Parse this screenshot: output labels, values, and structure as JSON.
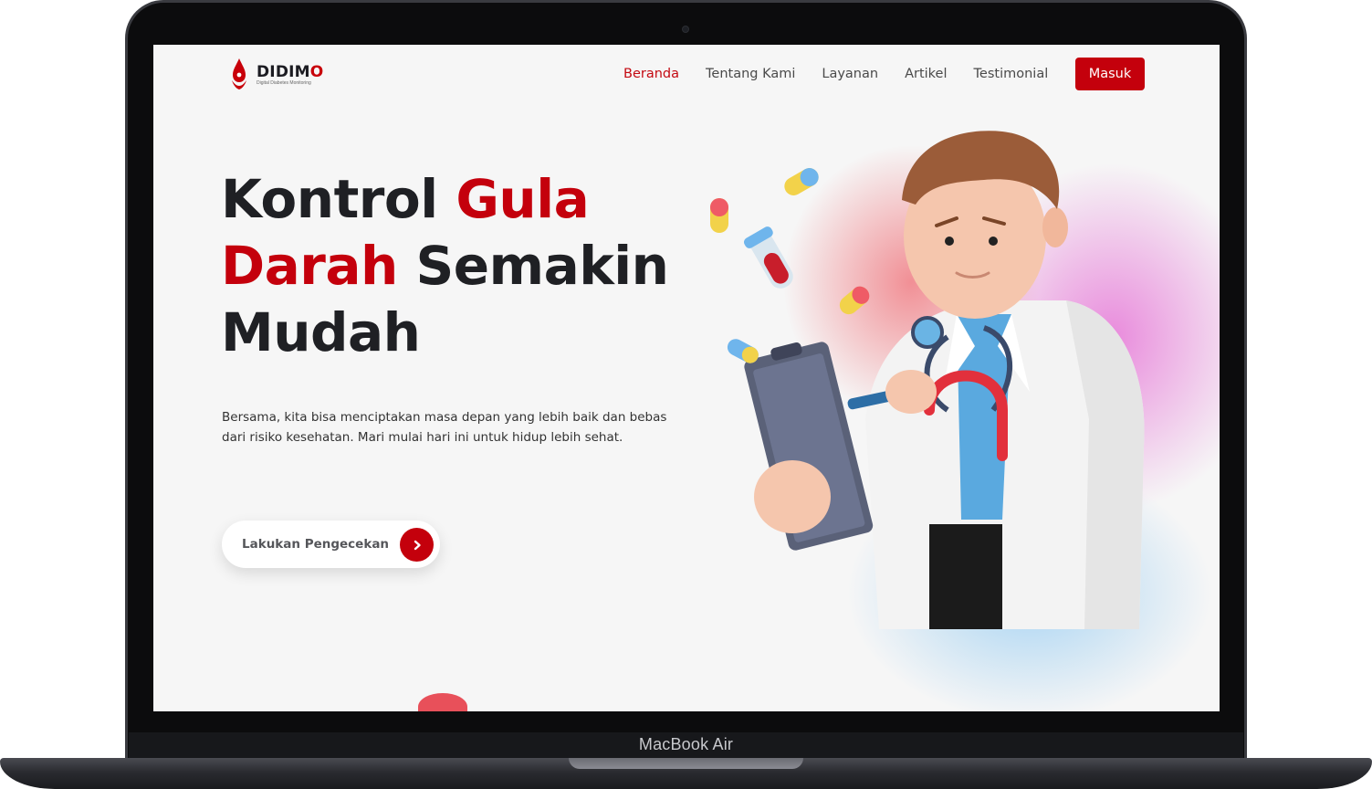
{
  "device": {
    "label": "MacBook Air"
  },
  "brand": {
    "name_main": "DIDIM",
    "name_accent": "O",
    "tagline": "Digital Diabetes Monitoring"
  },
  "nav": {
    "items": [
      {
        "label": "Beranda",
        "active": true
      },
      {
        "label": "Tentang Kami",
        "active": false
      },
      {
        "label": "Layanan",
        "active": false
      },
      {
        "label": "Artikel",
        "active": false
      },
      {
        "label": "Testimonial",
        "active": false
      }
    ],
    "login_label": "Masuk"
  },
  "hero": {
    "title_part1": "Kontrol ",
    "title_red1": "Gula",
    "title_red2": "Darah",
    "title_part2": " Semakin",
    "title_part3": "Mudah",
    "description": "Bersama, kita bisa menciptakan masa depan yang lebih baik dan bebas dari risiko kesehatan. Mari mulai hari ini untuk hidup lebih sehat.",
    "cta_label": "Lakukan Pengecekan"
  },
  "colors": {
    "accent": "#c4000c",
    "text_dark": "#1f2024",
    "background": "#f6f6f6"
  },
  "icons": {
    "logo": "blood-drop-icon",
    "cta_arrow": "chevron-right-icon"
  }
}
